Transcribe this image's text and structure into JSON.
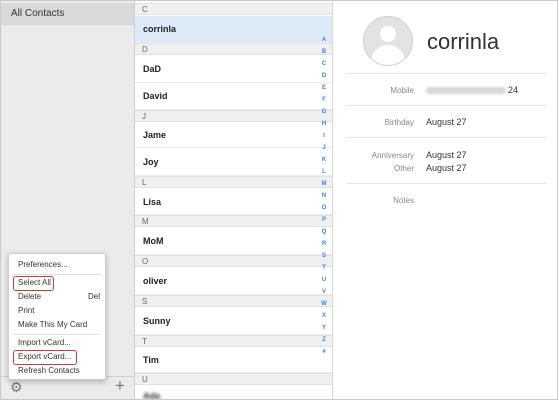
{
  "sidebar": {
    "all_contacts": "All Contacts"
  },
  "menu": {
    "preferences": "Preferences...",
    "select_all": "Select All",
    "delete": "Delete",
    "delete_shortcut": "Del",
    "print": "Print",
    "make_my_card": "Make This My Card",
    "import_vcard": "Import vCard...",
    "export_vcard": "Export vCard...",
    "refresh": "Refresh Contacts"
  },
  "contacts": {
    "headers": [
      "C",
      "D",
      "J",
      "L",
      "M",
      "O",
      "S",
      "T",
      "U"
    ],
    "names": [
      "corrinla",
      "DaD",
      "David",
      "Jame",
      "Joy",
      "Lisa",
      "MoM",
      "oliver",
      "Sunny",
      "Tim",
      "Ada"
    ]
  },
  "index_letters": [
    "A",
    "B",
    "C",
    "D",
    "E",
    "F",
    "G",
    "H",
    "I",
    "J",
    "K",
    "L",
    "M",
    "N",
    "O",
    "P",
    "Q",
    "R",
    "S",
    "T",
    "U",
    "V",
    "W",
    "X",
    "Y",
    "Z",
    "#"
  ],
  "detail": {
    "name": "corrinla",
    "mobile_label": "Mobile",
    "mobile_suffix": "24",
    "birthday_label": "Birthday",
    "birthday": "August 27",
    "anniversary_label": "Anniversary",
    "anniversary": "August 27",
    "other_label": "Other",
    "other": "August 27",
    "notes_label": "Notes"
  },
  "colors": {
    "accent": "#3e84d9",
    "highlight": "#d83a3a",
    "selected_row": "#ddeaf8"
  }
}
